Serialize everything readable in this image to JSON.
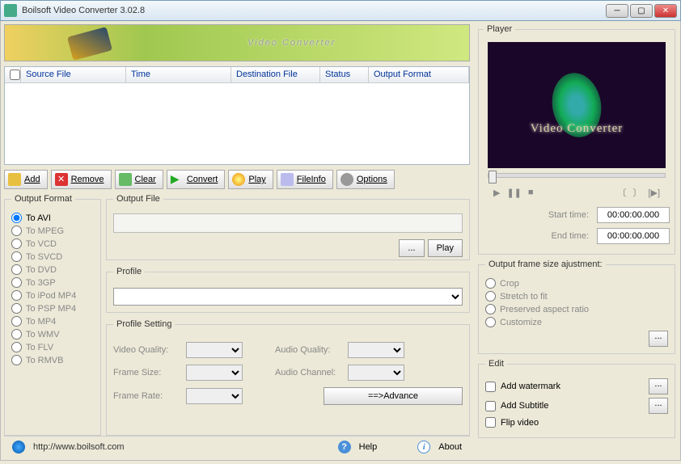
{
  "window": {
    "title": "Boilsoft Video Converter 3.02.8"
  },
  "banner": "Video Converter",
  "list_headers": {
    "source": "Source File",
    "time": "Time",
    "dest": "Destination File",
    "status": "Status",
    "fmt": "Output Format"
  },
  "toolbar": {
    "add": "Add",
    "remove": "Remove",
    "clear": "Clear",
    "convert": "Convert",
    "play": "Play",
    "fileinfo": "FileInfo",
    "options": "Options"
  },
  "outfmt": {
    "legend": "Output Format",
    "opts": [
      "To AVI",
      "To MPEG",
      "To VCD",
      "To SVCD",
      "To DVD",
      "To 3GP",
      "To iPod MP4",
      "To PSP MP4",
      "To MP4",
      "To WMV",
      "To FLV",
      "To RMVB"
    ],
    "selected": 0
  },
  "outfile": {
    "legend": "Output File",
    "browse": "...",
    "play": "Play"
  },
  "profile": {
    "legend": "Profile"
  },
  "psetting": {
    "legend": "Profile Setting",
    "vq": "Video Quality:",
    "fs": "Frame Size:",
    "fr": "Frame Rate:",
    "aq": "Audio Quality:",
    "ac": "Audio Channel:",
    "adv": "==>Advance"
  },
  "status": {
    "url": "http://www.boilsoft.com",
    "help": "Help",
    "about": "About"
  },
  "player": {
    "legend": "Player",
    "caption": "Video Converter",
    "start_lbl": "Start time:",
    "end_lbl": "End  time:",
    "start": "00:00:00.000",
    "end": "00:00:00.000"
  },
  "adjust": {
    "legend": "Output frame size ajustment:",
    "opts": [
      "Crop",
      "Stretch to fit",
      "Preserved aspect ratio",
      "Customize"
    ]
  },
  "edit": {
    "legend": "Edit",
    "watermark": "Add watermark",
    "subtitle": "Add Subtitle",
    "flip": "Flip video"
  }
}
